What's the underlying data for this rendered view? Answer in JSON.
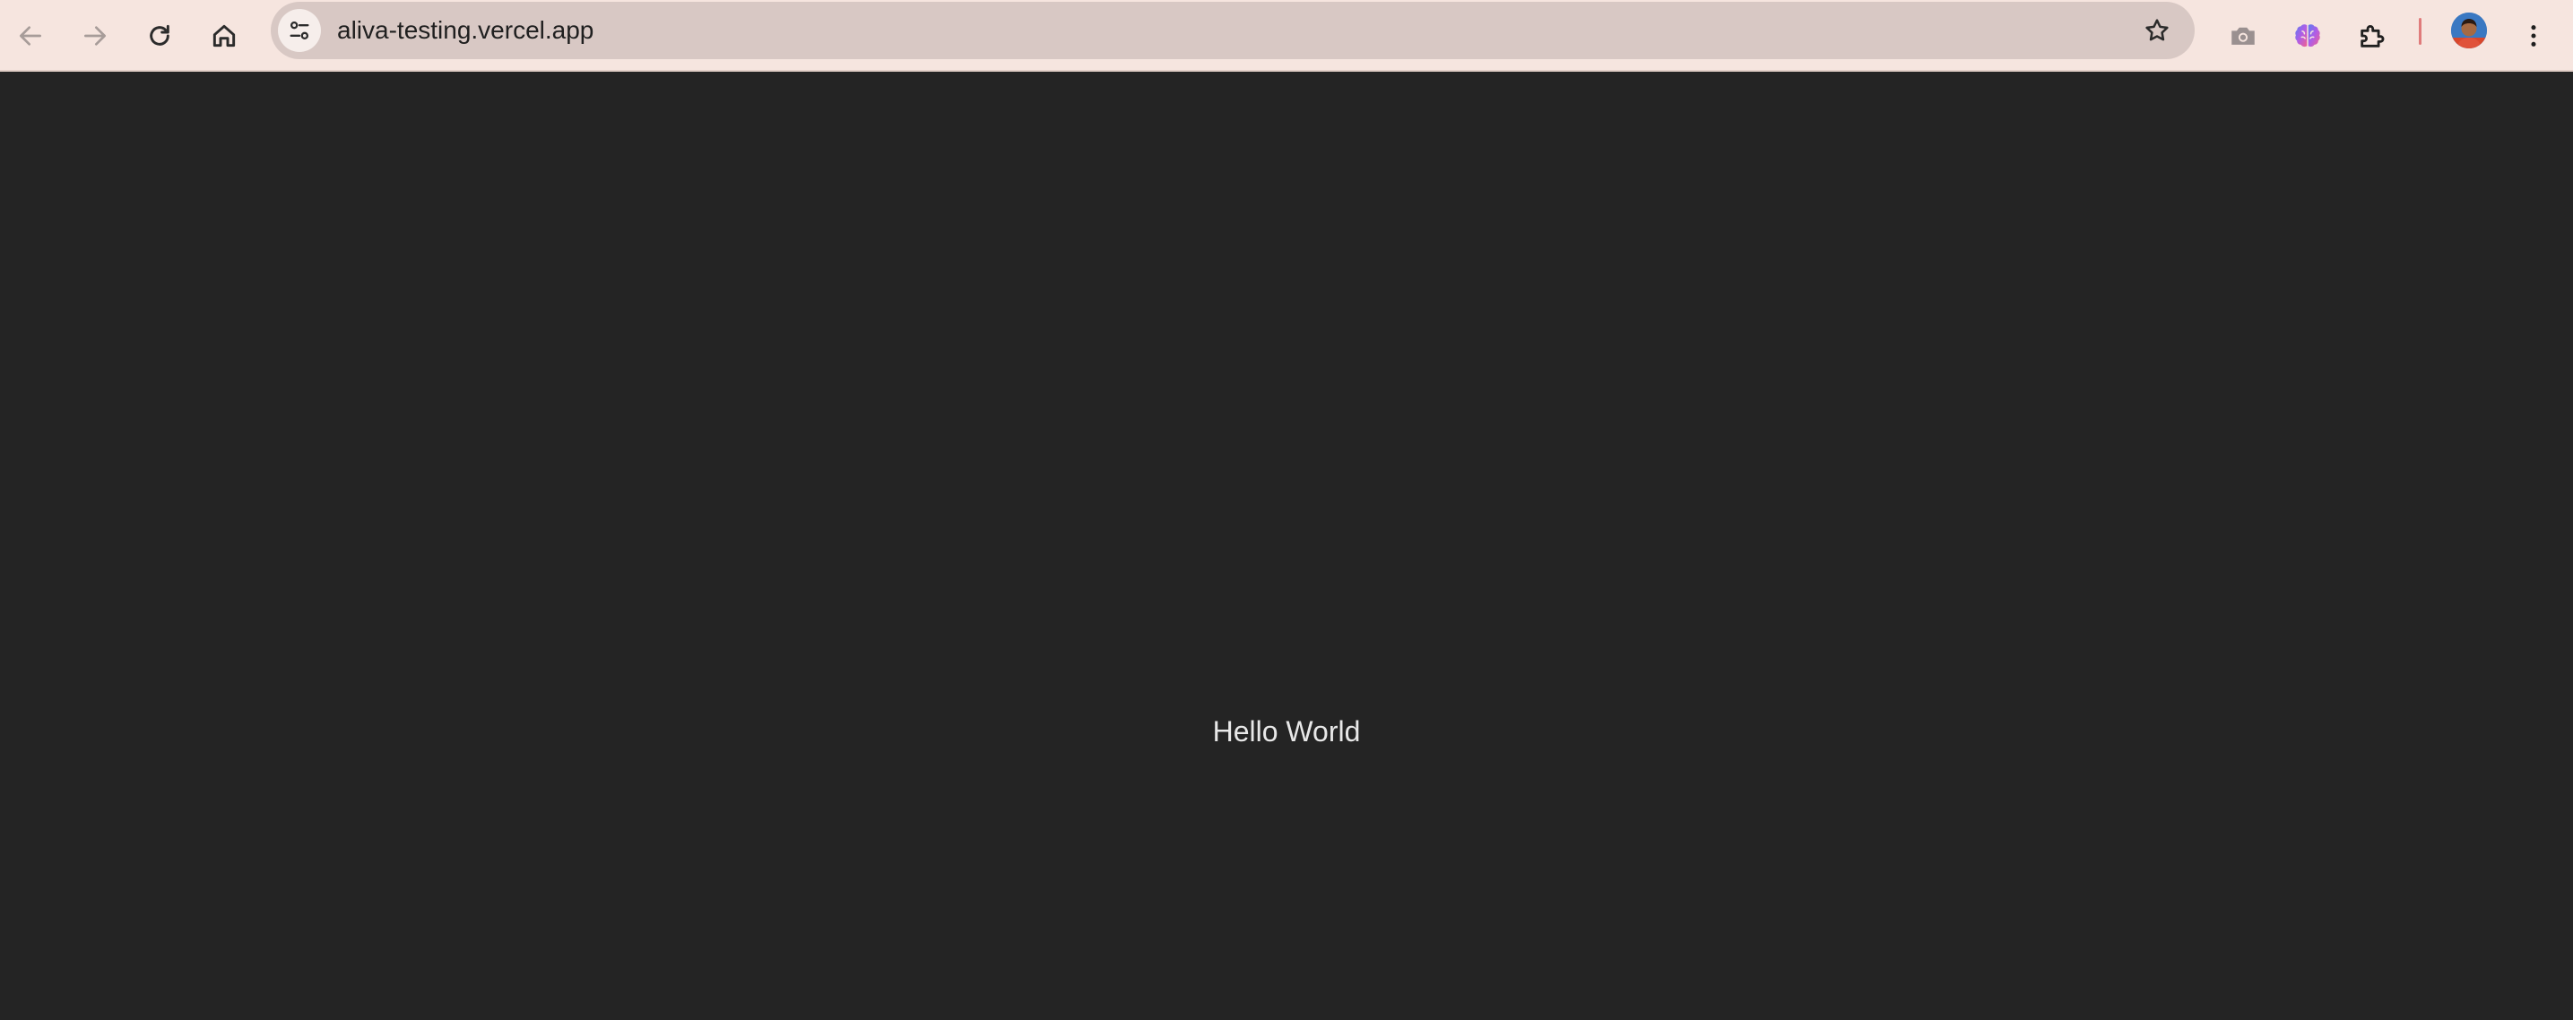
{
  "browser": {
    "url": "aliva-testing.vercel.app",
    "icons": {
      "back": "arrow-left-icon",
      "forward": "arrow-right-icon",
      "reload": "reload-icon",
      "home": "home-icon",
      "site_info": "tune-icon",
      "bookmark": "star-icon",
      "screenshot": "camera-icon",
      "extension_brain": "brain-icon",
      "extensions": "puzzle-icon",
      "profile": "avatar",
      "menu": "kebab-menu-icon"
    },
    "colors": {
      "toolbar": "#f6e5df",
      "omnibox": "#d8c8c4",
      "page_background": "#242424",
      "page_text": "#e8e8e8"
    }
  },
  "page": {
    "text": "Hello World"
  }
}
